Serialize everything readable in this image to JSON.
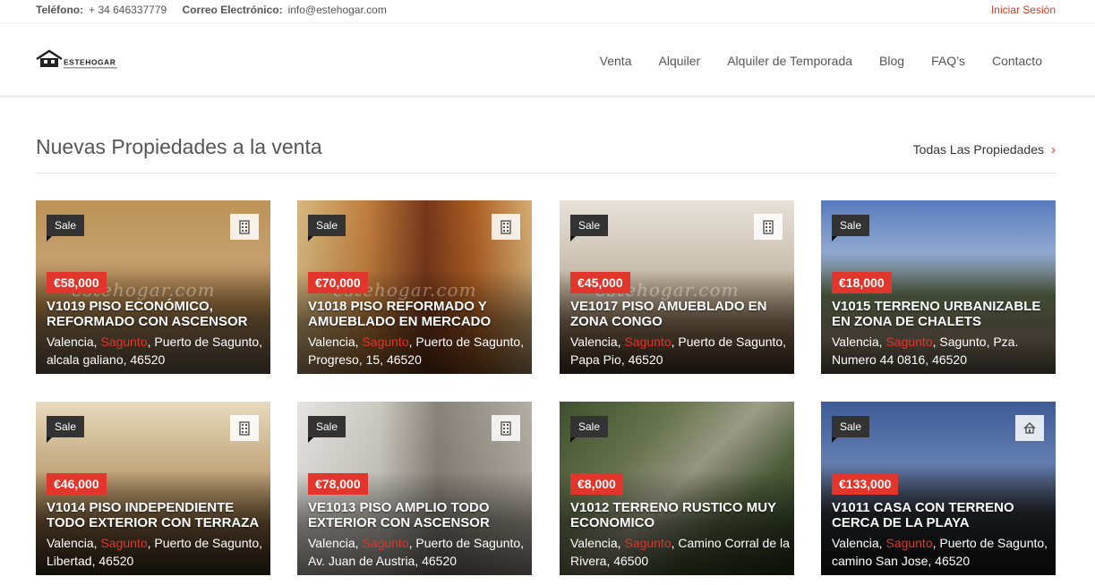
{
  "topbar": {
    "phone_label": "Teléfono:",
    "phone_value": "+ 34 646337779",
    "email_label": "Correo Electrónico:",
    "email_value": "info@estehogar.com",
    "login": "Iniciar Sesión"
  },
  "header": {
    "logo_text": "ESTEHOGAR",
    "nav": [
      "Venta",
      "Alquiler",
      "Alquiler de Temporada",
      "Blog",
      "FAQ’s",
      "Contacto"
    ]
  },
  "section": {
    "title": "Nuevas Propiedades a la venta",
    "all_link": "Todas Las Propiedades"
  },
  "watermark": "estehogar.com",
  "colors": {
    "accent": "#e2352b",
    "badge": "#333333"
  },
  "properties": [
    {
      "badge": "Sale",
      "type_icon": "building-icon",
      "price": "€58,000",
      "title": "V1019 PISO ECONÓMICO, REFORMADO CON ASCENSOR",
      "region": "Valencia, ",
      "city": "Sagunto",
      "address": ", Puerto de Sagunto, alcala galiano, 46520"
    },
    {
      "badge": "Sale",
      "type_icon": "building-icon",
      "price": "€70,000",
      "title": "V1018 PISO REFORMADO Y AMUEBLADO EN MERCADO",
      "region": "Valencia, ",
      "city": "Sagunto",
      "address": ", Puerto de Sagunto, Progreso, 15, 46520"
    },
    {
      "badge": "Sale",
      "type_icon": "building-icon",
      "price": "€45,000",
      "title": "VE1017 PISO AMUEBLADO EN ZONA CONGO",
      "region": "Valencia, ",
      "city": "Sagunto",
      "address": ", Puerto de Sagunto, Papa Pio, 46520"
    },
    {
      "badge": "Sale",
      "type_icon": "none",
      "price": "€18,000",
      "title": "V1015 TERRENO URBANIZABLE EN ZONA DE CHALETS",
      "region": "Valencia, ",
      "city": "Sagunto",
      "address": ", Sagunto, Pza. Numero 44 0816, 46520"
    },
    {
      "badge": "Sale",
      "type_icon": "building-icon",
      "price": "€46,000",
      "title": "V1014 PISO INDEPENDIENTE TODO EXTERIOR CON TERRAZA",
      "region": "Valencia, ",
      "city": "Sagunto",
      "address": ", Puerto de Sagunto, Libertad, 46520"
    },
    {
      "badge": "Sale",
      "type_icon": "building-icon",
      "price": "€78,000",
      "title": "VE1013 PISO AMPLIO TODO EXTERIOR CON ASCENSOR",
      "region": "Valencia, ",
      "city": "Sagunto",
      "address": ", Puerto de Sagunto, Av. Juan de Austria, 46520"
    },
    {
      "badge": "Sale",
      "type_icon": "none",
      "price": "€8,000",
      "title": "V1012 TERRENO RUSTICO MUY ECONOMICO",
      "region": "Valencia, ",
      "city": "Sagunto",
      "address": ", Camino Corral de la Rivera, 46500"
    },
    {
      "badge": "Sale",
      "type_icon": "house-icon",
      "price": "€133,000",
      "title": "V1011 CASA CON TERRENO CERCA DE LA PLAYA",
      "region": "Valencia, ",
      "city": "Sagunto",
      "address": ", Puerto de Sagunto, camino San Jose, 46520"
    }
  ]
}
